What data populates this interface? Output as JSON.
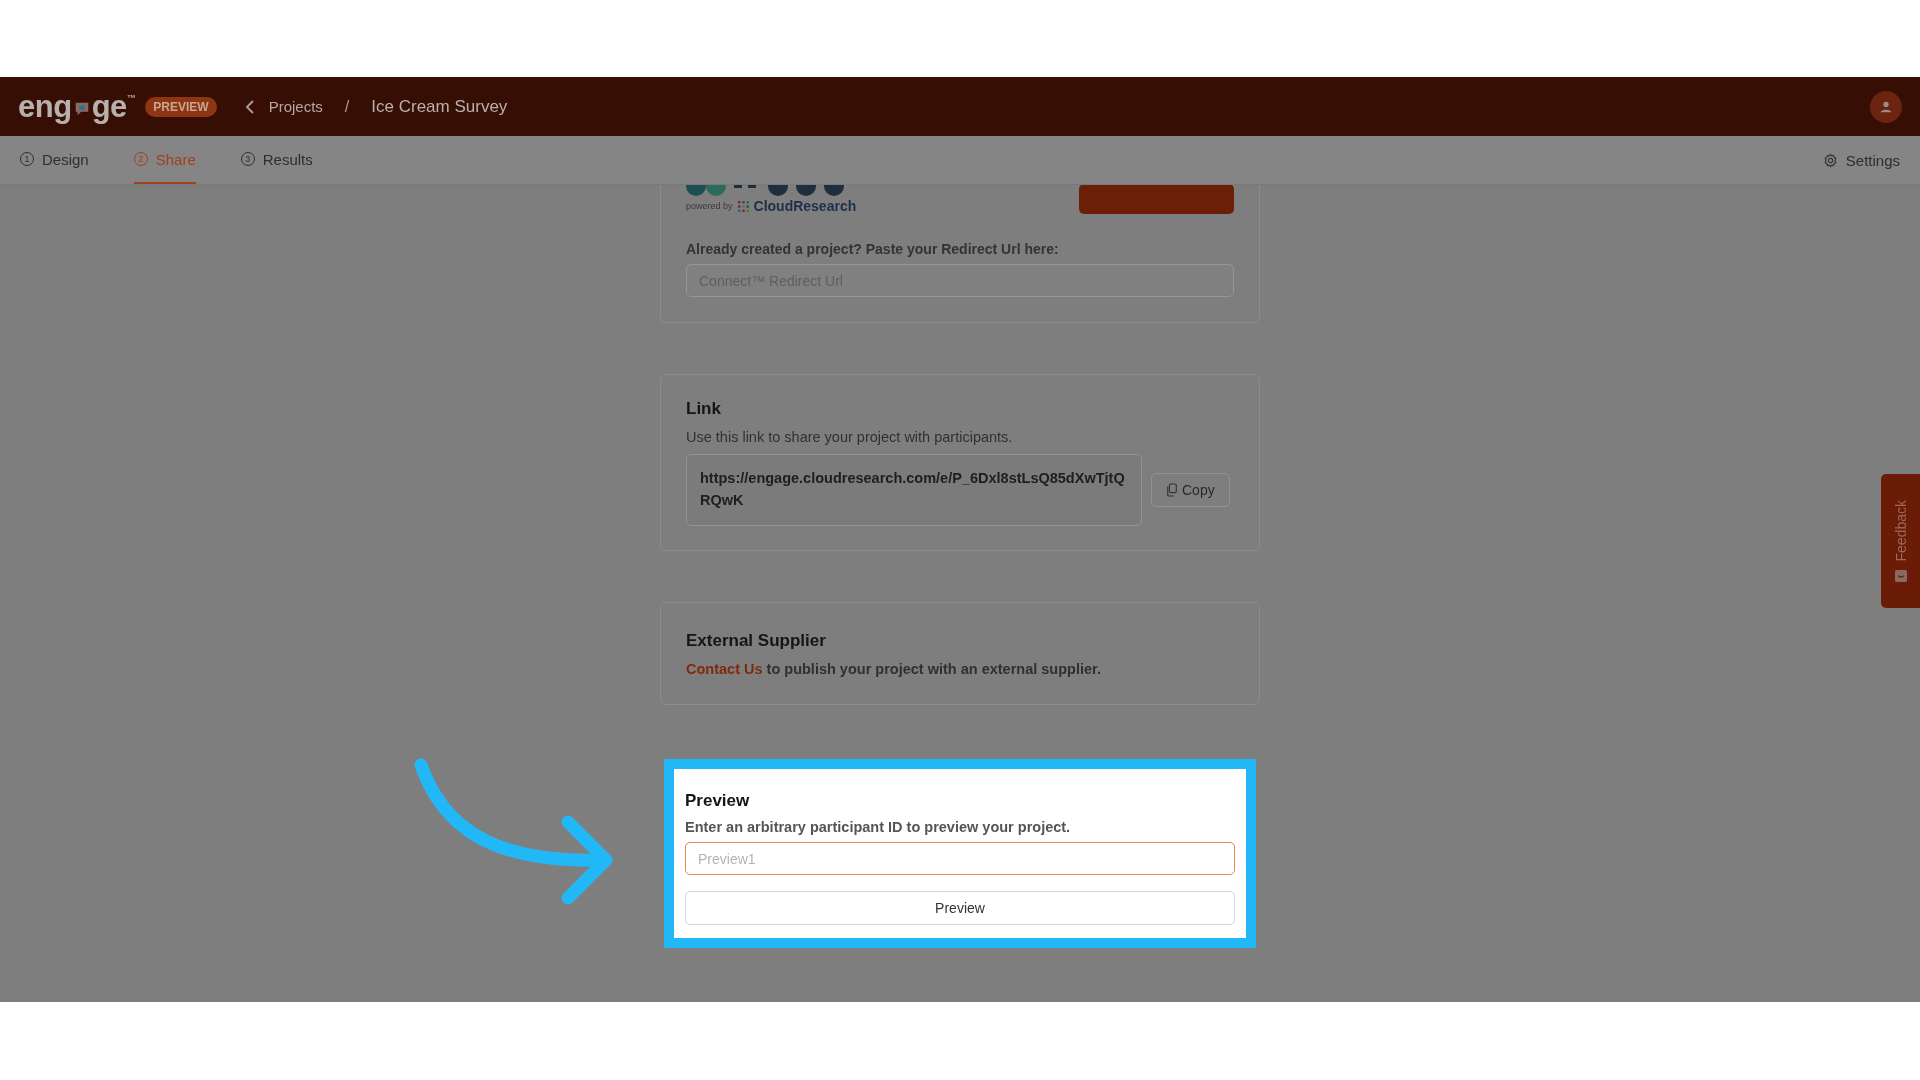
{
  "header": {
    "logo": {
      "before": "eng",
      "after": "ge",
      "mark": "™"
    },
    "badge": "PREVIEW",
    "breadcrumb": [
      {
        "label": "Projects",
        "kind": "link"
      },
      {
        "label": "Ice Cream Survey",
        "kind": "current"
      }
    ],
    "separator": "/"
  },
  "tabs": [
    {
      "number": "1",
      "label": "Design",
      "selected": false
    },
    {
      "number": "2",
      "label": "Share",
      "selected": true
    },
    {
      "number": "3",
      "label": "Results",
      "selected": false
    }
  ],
  "settings": "Settings",
  "connect_card": {
    "powered_by": "powered by",
    "brand": "CloudResearch",
    "label": "Already created a project? Paste your Redirect Url here:",
    "placeholder": "Connect™ Redirect Url"
  },
  "link_card": {
    "title": "Link",
    "description": "Use this link to share your project with participants.",
    "url": "https://engage.cloudresearch.com/e/P_6Dxl8stLsQ85dXwTjtQRQwK",
    "copy_button": "Copy"
  },
  "supplier_card": {
    "title": "External Supplier",
    "link": "Contact Us",
    "text": "to publish your project with an external supplier."
  },
  "preview_card": {
    "title": "Preview",
    "description": "Enter an arbitrary participant ID to preview your project.",
    "placeholder": "Preview1",
    "button": "Preview",
    "highlighted": true
  },
  "feedback": "Feedback"
}
